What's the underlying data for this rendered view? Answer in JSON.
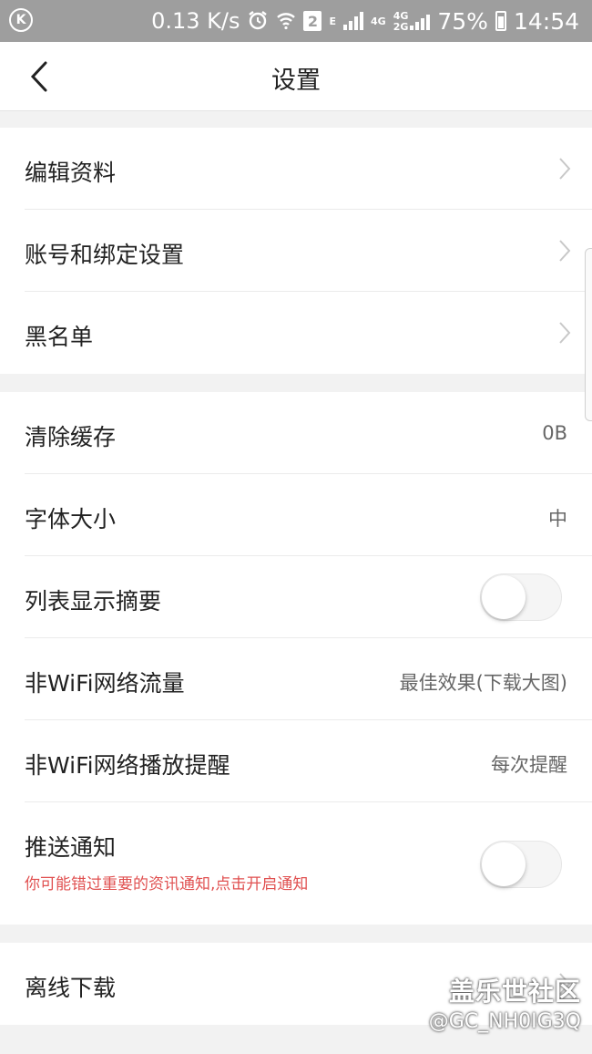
{
  "status_bar": {
    "logo": "K",
    "speed": "0.13 K/s",
    "sim_badge": "2",
    "net_e": "E",
    "net_4g": "4G",
    "net_dual_top": "4G",
    "net_dual_bottom": "2G",
    "battery": "75%",
    "time": "14:54",
    "icons": [
      "alarm-icon",
      "wifi-icon",
      "signal-icon",
      "battery-charging-icon"
    ]
  },
  "header": {
    "title": "设置",
    "back_icon": "chevron-left-icon"
  },
  "group1": [
    {
      "label": "编辑资料"
    },
    {
      "label": "账号和绑定设置"
    },
    {
      "label": "黑名单"
    }
  ],
  "group2": {
    "clear_cache": {
      "label": "清除缓存",
      "value": "0B"
    },
    "font_size": {
      "label": "字体大小",
      "value": "中"
    },
    "list_summary": {
      "label": "列表显示摘要",
      "enabled": false
    },
    "non_wifi_traffic": {
      "label": "非WiFi网络流量",
      "value": "最佳效果(下载大图)"
    },
    "non_wifi_play": {
      "label": "非WiFi网络播放提醒",
      "value": "每次提醒"
    },
    "push": {
      "label": "推送通知",
      "sub": "你可能错过重要的资讯通知,点击开启通知",
      "enabled": false
    }
  },
  "group3": [
    {
      "label": "离线下载"
    }
  ],
  "watermark": {
    "line1": "盖乐世社区",
    "line2": "@GC_NH0IG3Q"
  }
}
